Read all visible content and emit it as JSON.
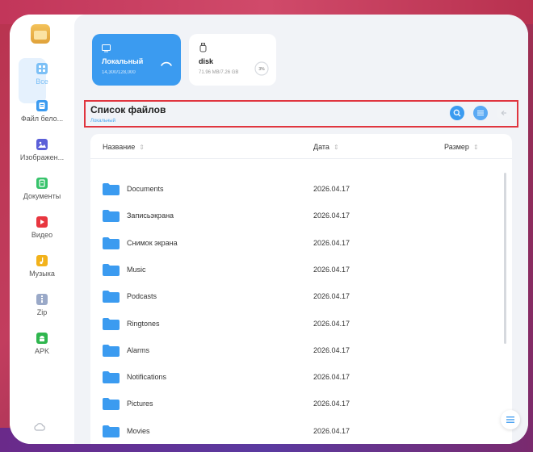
{
  "sidebar": {
    "items": [
      {
        "label": "Все",
        "icon": "grid-icon",
        "color": "#4aa8f0"
      },
      {
        "label": "Файл бело...",
        "icon": "whitelist-file-icon",
        "color": "#3b9bf0"
      },
      {
        "label": "Изображен...",
        "icon": "image-icon",
        "color": "#5b5fd8"
      },
      {
        "label": "Документы",
        "icon": "document-icon",
        "color": "#37c36b"
      },
      {
        "label": "Видео",
        "icon": "video-icon",
        "color": "#e8363f"
      },
      {
        "label": "Музыка",
        "icon": "music-icon",
        "color": "#f2b21b"
      },
      {
        "label": "Zip",
        "icon": "zip-icon",
        "color": "#9aa9c8"
      },
      {
        "label": "APK",
        "icon": "android-icon",
        "color": "#2fb64e"
      }
    ]
  },
  "storage": {
    "local": {
      "title": "Локальный",
      "usage": "14,300/128,000"
    },
    "disk": {
      "title": "disk",
      "usage": "71.96 MB/7.26 GB",
      "percent": "3%"
    }
  },
  "list": {
    "title": "Список файлов",
    "path": "Локальный"
  },
  "table": {
    "headers": {
      "name": "Название",
      "date": "Дата",
      "size": "Размер"
    },
    "rows": [
      {
        "name": "Documents",
        "date": "2026.04.17"
      },
      {
        "name": "Записьэкрана",
        "date": "2026.04.17"
      },
      {
        "name": "Снимок экрана",
        "date": "2026.04.17"
      },
      {
        "name": "Music",
        "date": "2026.04.17"
      },
      {
        "name": "Podcasts",
        "date": "2026.04.17"
      },
      {
        "name": "Ringtones",
        "date": "2026.04.17"
      },
      {
        "name": "Alarms",
        "date": "2026.04.17"
      },
      {
        "name": "Notifications",
        "date": "2026.04.17"
      },
      {
        "name": "Pictures",
        "date": "2026.04.17"
      },
      {
        "name": "Movies",
        "date": "2026.04.17"
      }
    ]
  },
  "colors": {
    "accent": "#3b9bf0",
    "highlight_border": "#e0353f",
    "folder": "#3b9bf0"
  }
}
